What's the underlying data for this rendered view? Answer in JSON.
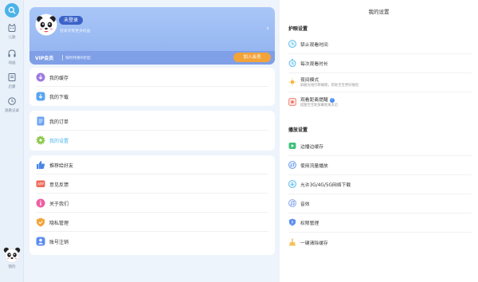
{
  "rail": {
    "items": [
      {
        "label": "儿歌",
        "icon": "cat-icon"
      },
      {
        "label": "动画",
        "icon": "headphones-icon"
      },
      {
        "label": "启蒙",
        "icon": "book-icon"
      },
      {
        "label": "观看记录",
        "icon": "clock-icon"
      }
    ],
    "avatar_label": "我的"
  },
  "profile": {
    "login_label": "未登录",
    "login_sub": "登录享受更多权益",
    "vip_title": "VIP会员",
    "vip_sub": "限时特惠6折起",
    "vip_button": "加入会员"
  },
  "menu": {
    "group1": [
      {
        "label": "我的缓存",
        "icon": "download-cache-icon"
      },
      {
        "label": "我的下载",
        "icon": "download-icon"
      }
    ],
    "group2": [
      {
        "label": "我的订单",
        "icon": "order-icon"
      },
      {
        "label": "我的设置",
        "icon": "gear-icon",
        "active": true
      }
    ],
    "group3": [
      {
        "label": "推荐给好友",
        "icon": "thumbs-up-icon"
      },
      {
        "label": "意见反馈",
        "icon": "feedback-icon"
      },
      {
        "label": "关于我们",
        "icon": "info-icon"
      },
      {
        "label": "隐私管理",
        "icon": "shield-icon"
      },
      {
        "label": "账号注销",
        "icon": "account-icon"
      }
    ]
  },
  "settings": {
    "title": "我的设置",
    "eye_section": "护眼设置",
    "eye_items": [
      {
        "label": "禁止观看时间",
        "sub": ""
      },
      {
        "label": "每次观看时长",
        "sub": ""
      },
      {
        "label": "夜间模式",
        "sub": "屏蔽光线打断睡眠，帮助宝宝更好睡觉"
      },
      {
        "label": "观看距离提醒",
        "sub": "提醒宝宝距屏幕距离太近"
      }
    ],
    "play_section": "播放设置",
    "play_items": [
      {
        "label": "边播边缓存"
      },
      {
        "label": "使用流量播放"
      },
      {
        "label": "允许3G/4G/5G网络下载"
      },
      {
        "label": "音效"
      },
      {
        "label": "权限管理"
      },
      {
        "label": "一键清除缓存"
      }
    ]
  },
  "colors": {
    "accent": "#47b6e8",
    "vip_button": "#f2a33a",
    "login_pill": "#3b62c8"
  }
}
